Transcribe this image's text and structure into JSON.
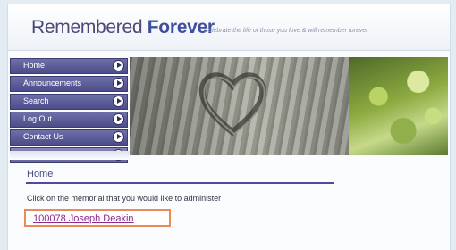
{
  "header": {
    "brand_light": "Remembered",
    "brand_bold": "Forever",
    "tagline": "Celebrate the life of those you love & will remember forever"
  },
  "nav": {
    "items": [
      {
        "label": "Home"
      },
      {
        "label": "Announcements"
      },
      {
        "label": "Search"
      },
      {
        "label": "Log Out"
      },
      {
        "label": "Contact Us"
      },
      {
        "label": ""
      }
    ]
  },
  "content": {
    "title": "Home",
    "instruction": "Click on the memorial that you would like to administer",
    "memorial_link": "100078 Joseph Deakin"
  },
  "colors": {
    "nav_background": "#5a5a96",
    "brand": "#3f4fa0",
    "link": "#8a2a8a",
    "highlight_border": "#ea8a5a"
  },
  "icons": {
    "nav_arrow": "circle-arrow-right-icon"
  }
}
